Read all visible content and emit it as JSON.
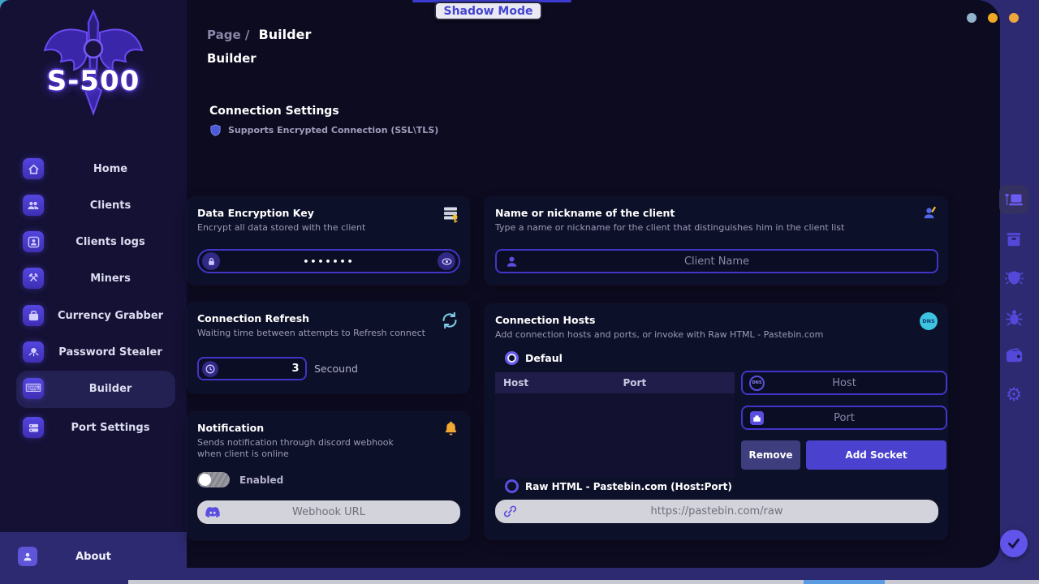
{
  "window": {
    "tooltip": "Shadow Mode"
  },
  "branding": {
    "logo_text": "S-500"
  },
  "breadcrumb": {
    "root": "Page",
    "separator": "/",
    "current": "Builder"
  },
  "page_title": "Builder",
  "section": {
    "title": "Connection Settings",
    "subtitle": "Supports Encrypted Connection (SSL\\TLS)"
  },
  "sidebar": {
    "items": [
      {
        "label": "Home",
        "icon": "home-icon",
        "active": false
      },
      {
        "label": "Clients",
        "icon": "users-icon",
        "active": false
      },
      {
        "label": "Clients logs",
        "icon": "user-log-icon",
        "active": false
      },
      {
        "label": "Miners",
        "icon": "pickaxe-icon",
        "active": false
      },
      {
        "label": "Currency Grabber",
        "icon": "wallet-icon",
        "active": false
      },
      {
        "label": "Password Stealer",
        "icon": "octopus-icon",
        "active": false
      },
      {
        "label": "Builder",
        "icon": "keyboard-icon",
        "active": true
      },
      {
        "label": "Port Settings",
        "icon": "server-icon",
        "active": false
      }
    ],
    "about_label": "About"
  },
  "cards": {
    "encryption": {
      "title": "Data Encryption Key",
      "subtitle": "Encrypt all data stored with the client",
      "value": "•••••••"
    },
    "client_name": {
      "title": "Name or nickname of the client",
      "subtitle": "Type a name or nickname for the client that distinguishes him in the client list",
      "placeholder": "Client Name"
    },
    "refresh": {
      "title": "Connection Refresh",
      "subtitle": "Waiting time between attempts to Refresh connect",
      "value": "3",
      "unit": "Secound"
    },
    "notification": {
      "title": "Notification",
      "subtitle": "Sends notification through discord webhook\n when client is online",
      "toggle_label": "Enabled",
      "toggle_state": "off",
      "webhook_placeholder": "Webhook URL"
    },
    "hosts": {
      "title": "Connection Hosts",
      "subtitle": "Add connection hosts and ports, or invoke with Raw HTML - Pastebin.com",
      "dns_badge": "DNS",
      "radio_default_label": "Defaul",
      "radio_default_selected": true,
      "table_headers": [
        "Host",
        "Port"
      ],
      "table_rows": [],
      "host_placeholder": "Host",
      "port_placeholder": "Port",
      "remove_label": "Remove",
      "add_label": "Add Socket",
      "radio_raw_label": "Raw HTML - Pastebin.com (Host:Port)",
      "radio_raw_selected": false,
      "raw_placeholder": "https://pastebin.com/raw"
    }
  },
  "colors": {
    "accent": "#5b4ee8",
    "frame": "#2e2a71",
    "card_bg": "#0d1029",
    "input_border": "#4334c8",
    "dns_cyan": "#3cc4e0",
    "bell_orange": "#f0a830",
    "dot_blue": "#93b3cc",
    "dot_orange": "#f0a824"
  }
}
